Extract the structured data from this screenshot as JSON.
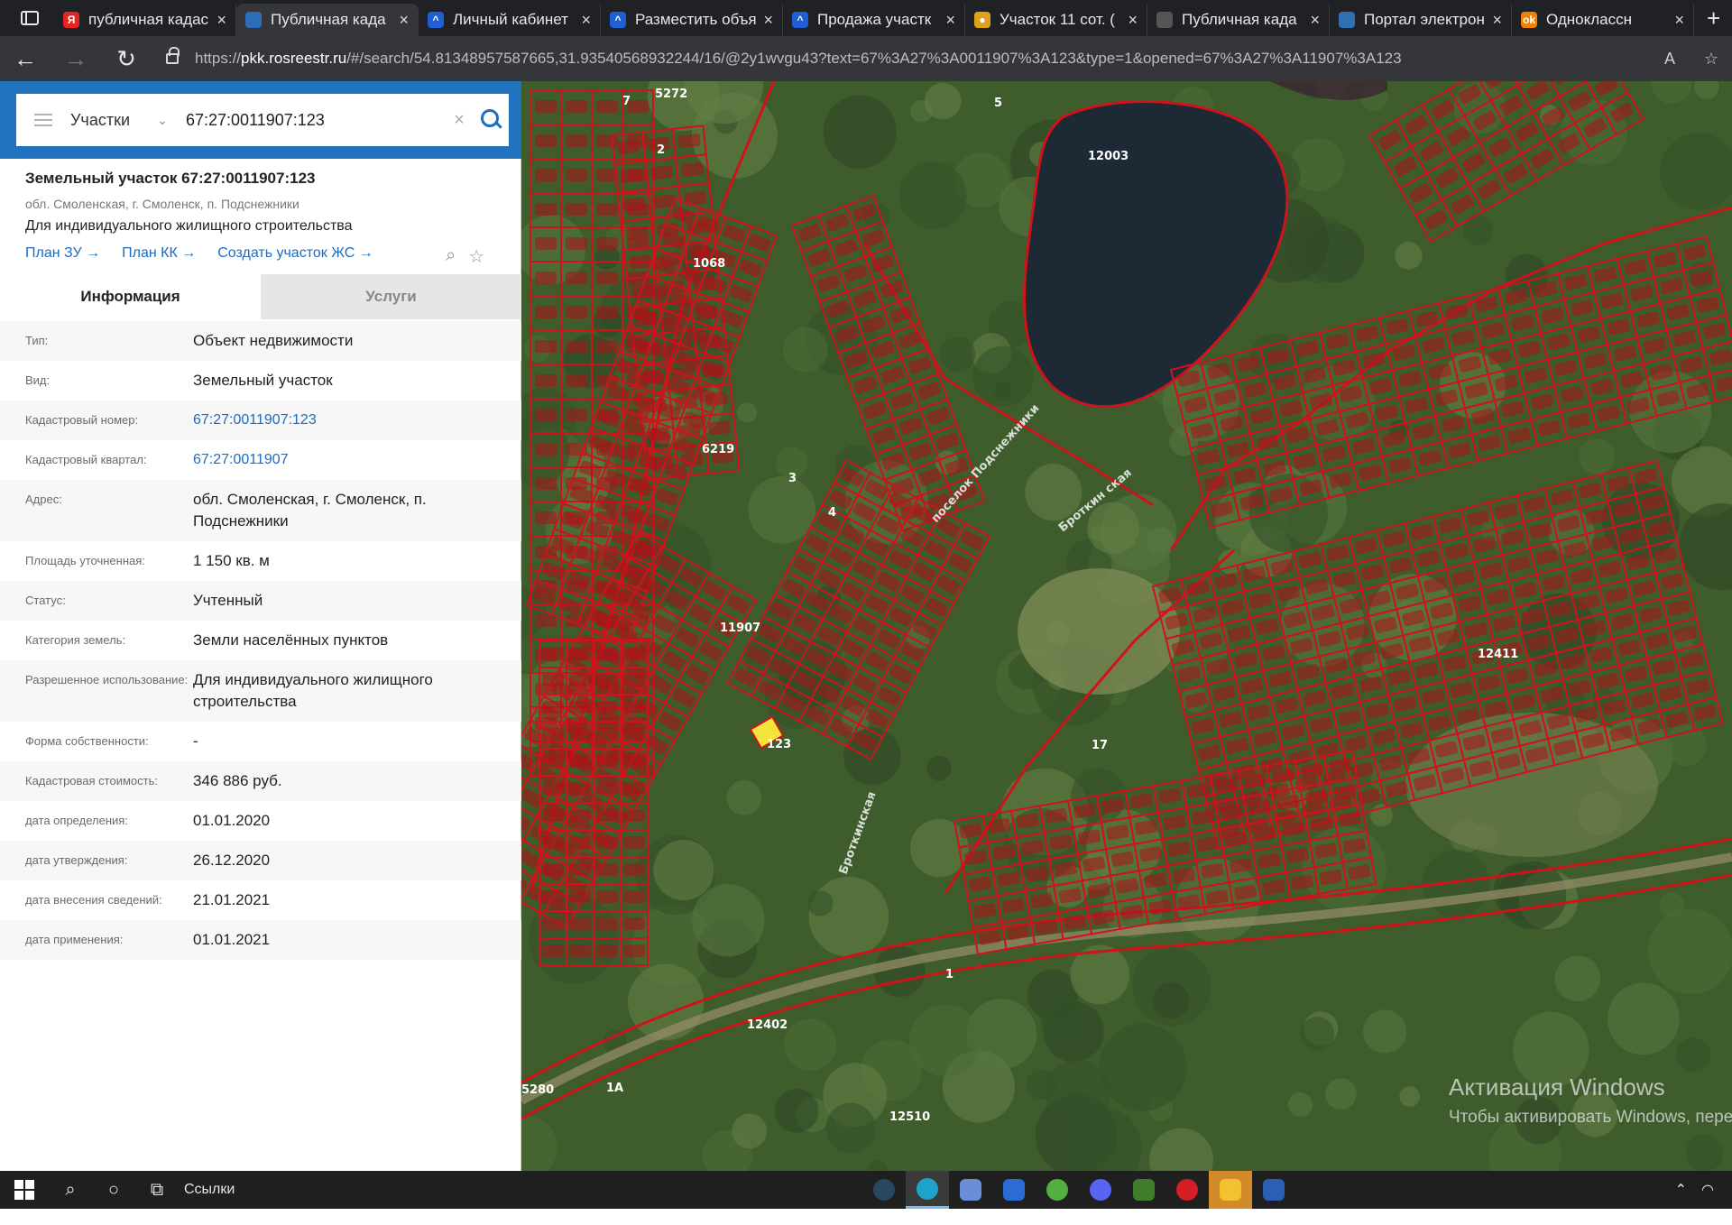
{
  "browser": {
    "tabs": [
      {
        "title": "публичная кадас",
        "favicon_color": "#e52620",
        "favicon_text": "Я"
      },
      {
        "title": "Публичная када",
        "favicon_color": "#2a6fb8",
        "favicon_text": "",
        "active": true
      },
      {
        "title": "Личный кабинет",
        "favicon_color": "#1e5fd6",
        "favicon_text": "^"
      },
      {
        "title": "Разместить объя",
        "favicon_color": "#1e5fd6",
        "favicon_text": "^"
      },
      {
        "title": "Продажа участк",
        "favicon_color": "#1e5fd6",
        "favicon_text": "^"
      },
      {
        "title": "Участок 11 сот. (",
        "favicon_color": "#e0a21a",
        "favicon_text": "●"
      },
      {
        "title": "Публичная када",
        "favicon_color": "#555555",
        "favicon_text": ""
      },
      {
        "title": "Портал электрон",
        "favicon_color": "#2f6fb3",
        "favicon_text": ""
      },
      {
        "title": "Одноклассн",
        "favicon_color": "#ee8208",
        "favicon_text": "ok"
      }
    ],
    "url_prefix": "https://",
    "url_host": "pkk.rosreestr.ru",
    "url_path": "/#/search/54.81348957587665,31.93540568932244/16/@2y1wvgu43?text=67%3A27%3A0011907%3A123&type=1&opened=67%3A27%3A11907%3A123"
  },
  "search": {
    "type_label": "Участки",
    "query": "67:27:0011907:123"
  },
  "parcel": {
    "title": "Земельный участок 67:27:0011907:123",
    "address_line": "обл. Смоленская, г. Смоленск, п. Подснежники",
    "usage_line": "Для индивидуального жилищного строительства",
    "links": [
      "План ЗУ →",
      "План КК →",
      "Создать участок ЖС →"
    ]
  },
  "info_tabs": {
    "info": "Информация",
    "services": "Услуги"
  },
  "fields": [
    {
      "key": "Тип:",
      "value": "Объект недвижимости"
    },
    {
      "key": "Вид:",
      "value": "Земельный участок"
    },
    {
      "key": "Кадастровый номер:",
      "value": "67:27:0011907:123",
      "link": true
    },
    {
      "key": "Кадастровый квартал:",
      "value": "67:27:0011907",
      "link": true
    },
    {
      "key": "Адрес:",
      "value": "обл. Смоленская, г. Смоленск, п. Подснежники"
    },
    {
      "key": "Площадь уточненная:",
      "value": "1 150 кв. м"
    },
    {
      "key": "Статус:",
      "value": "Учтенный"
    },
    {
      "key": "Категория земель:",
      "value": "Земли населённых пунктов"
    },
    {
      "key": "Разрешенное использование:",
      "value": "Для индивидуального жилищного строительства"
    },
    {
      "key": "Форма собственности:",
      "value": "-"
    },
    {
      "key": "Кадастровая стоимость:",
      "value": "346 886 руб."
    },
    {
      "key": "дата определения:",
      "value": "01.01.2020"
    },
    {
      "key": "дата утверждения:",
      "value": "26.12.2020"
    },
    {
      "key": "дата внесения сведений:",
      "value": "21.01.2021"
    },
    {
      "key": "дата применения:",
      "value": "01.01.2021"
    }
  ],
  "map": {
    "labels": [
      "12003",
      "11907",
      "12411",
      "12402",
      "12510",
      "17",
      "5",
      "7",
      "2",
      "123",
      "6219",
      "1068",
      "5272",
      "5280",
      "1A",
      "3",
      "4",
      "1"
    ],
    "road_labels": [
      "поселок Подснежники",
      "Броткин ская",
      "Броткинская"
    ],
    "watermark_title": "Активация Windows",
    "watermark_text": "Чтобы активировать Windows, пере \"Параметры\"."
  },
  "taskbar": {
    "links_label": "Ссылки"
  },
  "colors": {
    "accent": "#2273bf",
    "link": "#1b6cc4",
    "parcel_border": "#d0121b",
    "selected_parcel": "#f2e43a"
  }
}
